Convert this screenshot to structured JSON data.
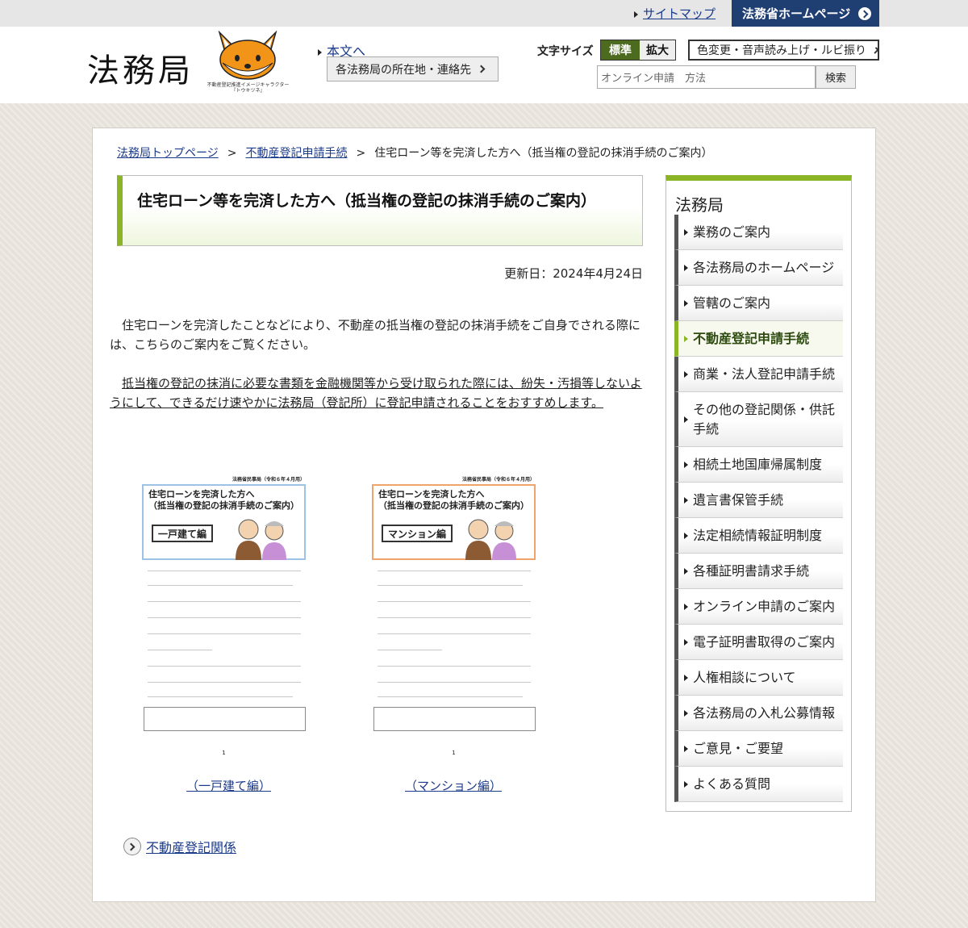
{
  "topbar": {
    "sitemap": "サイトマップ",
    "moj_home": "法務省ホームページ"
  },
  "header": {
    "logo": "法務局",
    "mascot_caption_1": "不動産登記推進イメージキャラクター",
    "mascot_caption_2": "『トウキツネ』",
    "skip_link": "本文へ",
    "contact_button": "各法務局の所在地・連絡先",
    "font_size_label": "文字サイズ",
    "font_standard": "標準",
    "font_large": "拡大",
    "color_button": "色変更・音声読み上げ・ルビ振り",
    "search_value": "オンライン申請　方法",
    "search_button": "検索"
  },
  "breadcrumb": {
    "items": [
      "法務局トップページ",
      "不動産登記申請手続"
    ],
    "separator": ">",
    "current": "住宅ローン等を完済した方へ（抵当権の登記の抹消手続のご案内）"
  },
  "main": {
    "title": "住宅ローン等を完済した方へ（抵当権の登記の抹消手続のご案内）",
    "updated": "更新日：2024年4月24日",
    "para1": "住宅ローンを完済したことなどにより、不動産の抵当権の登記の抹消手続をご自身でされる際には、こちらのご案内をご覧ください。",
    "para2": "抵当権の登記の抹消に必要な書類を金融機関等から受け取られた際には、紛失・汚損等しないようにして、できるだけ速やかに法務局（登記所）に登記申請されることをおすすめします。",
    "thumb_header": "法務省民事局（令和６年４月用）",
    "thumb_title_1": "住宅ローンを完済した方へ",
    "thumb_title_2": "（抵当権の登記の抹消手続のご案内）",
    "thumb1_label": "一戸建て編",
    "thumb2_label": "マンション編",
    "thumb_page": "1",
    "link1": "（一戸建て編）",
    "link2": "（マンション編）",
    "related": "不動産登記関係"
  },
  "side": {
    "title": "法務局",
    "items": [
      "業務のご案内",
      "各法務局のホームページ",
      "管轄のご案内",
      "不動産登記申請手続",
      "商業・法人登記申請手続",
      "その他の登記関係・供託手続",
      "相続土地国庫帰属制度",
      "遺言書保管手続",
      "法定相続情報証明制度",
      "各種証明書請求手続",
      "オンライン申請のご案内",
      "電子証明書取得のご案内",
      "人権相談について",
      "各法務局の入札公募情報",
      "ご意見・ご要望",
      "よくある質問"
    ],
    "active_index": 3
  },
  "colors": {
    "accent_green": "#8bb527",
    "navy": "#1f3f73",
    "link": "#1a3a8a"
  }
}
